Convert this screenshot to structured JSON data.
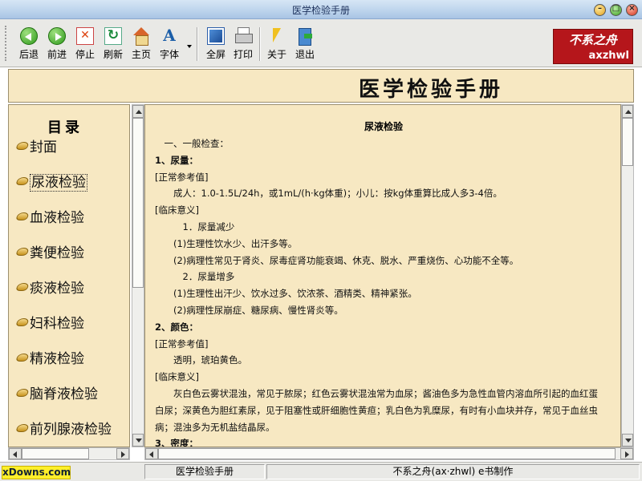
{
  "window": {
    "title": "医学检验手册",
    "controls": [
      "minimize",
      "maximize",
      "close"
    ]
  },
  "toolbar": {
    "buttons": [
      {
        "label": "后退",
        "icon": "back-arrow-icon"
      },
      {
        "label": "前进",
        "icon": "forward-arrow-icon"
      },
      {
        "label": "停止",
        "icon": "stop-icon"
      },
      {
        "label": "刷新",
        "icon": "refresh-icon"
      },
      {
        "label": "主页",
        "icon": "home-icon"
      },
      {
        "label": "字体",
        "icon": "font-icon"
      },
      {
        "label": "全屏",
        "icon": "fullscreen-icon"
      },
      {
        "label": "打印",
        "icon": "printer-icon"
      },
      {
        "label": "关于",
        "icon": "about-cursor-icon"
      },
      {
        "label": "退出",
        "icon": "exit-icon"
      }
    ],
    "logo": {
      "line1": "不系之舟",
      "line2": "axzhwl"
    }
  },
  "header": {
    "title": "医学检验手册"
  },
  "toc": {
    "title": "目录",
    "items": [
      "封面",
      "尿液检验",
      "血液检验",
      "粪便检验",
      "痰液检验",
      "妇科检验",
      "精液检验",
      "脑脊液检验",
      "前列腺液检验"
    ],
    "active_index": 1
  },
  "content": {
    "title": "尿液检验",
    "lines": [
      {
        "text": "　一、一般检查：",
        "bold": false
      },
      {
        "text": "1、尿量：",
        "bold": true
      },
      {
        "text": "[正常参考值]",
        "bold": false
      },
      {
        "text": "　　成人：1.0-1.5L/24h，或1mL/(h·kg体重)；小儿：按kg体重算比成人多3-4倍。",
        "bold": false
      },
      {
        "text": "[临床意义]",
        "bold": false
      },
      {
        "text": "　　　1．尿量减少",
        "bold": false
      },
      {
        "text": "　　(1)生理性饮水少、出汗多等。",
        "bold": false
      },
      {
        "text": "　　(2)病理性常见于肾炎、尿毒症肾功能衰竭、休克、脱水、严重烧伤、心功能不全等。",
        "bold": false
      },
      {
        "text": "　　　2．尿量增多",
        "bold": false
      },
      {
        "text": "　　(1)生理性出汗少、饮水过多、饮浓茶、酒精类、精神紧张。",
        "bold": false
      },
      {
        "text": "　　(2)病理性尿崩症、糖尿病、慢性肾炎等。",
        "bold": false
      },
      {
        "text": "2、颜色：",
        "bold": true
      },
      {
        "text": "[正常参考值]",
        "bold": false
      },
      {
        "text": "　　透明，琥珀黄色。",
        "bold": false
      },
      {
        "text": "[临床意义]",
        "bold": false
      },
      {
        "text": "　　灰白色云雾状混浊，常见于脓尿；红色云雾状混浊常为血尿；酱油色多为急性血管内溶血所引起的血红蛋",
        "bold": false
      },
      {
        "text": "白尿；深黄色为胆红素尿，见于阻塞性或肝细胞性黄疸；乳白色为乳糜尿，有时有小血块并存，常见于血丝虫",
        "bold": false
      },
      {
        "text": "病；混浊多为无机盐结晶尿。",
        "bold": false
      },
      {
        "text": "3、密度：",
        "bold": true
      }
    ]
  },
  "statusbar": {
    "badge": "xDowns.com",
    "panel1": "医学检验手册",
    "panel2": "不系之舟(ax·zhwl) e书制作"
  },
  "colors": {
    "content_bg": "#f7e8c2",
    "chrome_bg": "#e9e9e6",
    "logo_bg": "#b5161b",
    "badge_bg": "#ffef2a"
  }
}
